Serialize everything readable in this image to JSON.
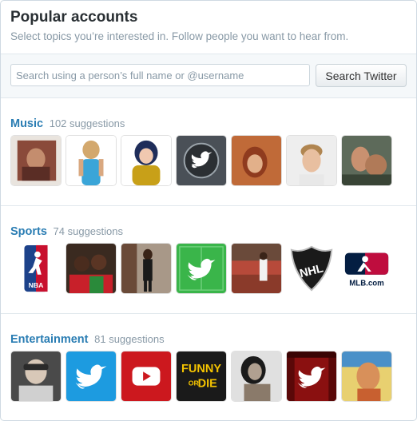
{
  "header": {
    "title": "Popular accounts",
    "subtitle": "Select topics you’re interested in. Follow people you want to hear from."
  },
  "search": {
    "placeholder": "Search using a person’s full name or @username",
    "button_label": "Search Twitter"
  },
  "sections": [
    {
      "name": "Music",
      "count": "102 suggestions",
      "accounts": [
        "photo-avatar",
        "photo-avatar",
        "photo-avatar",
        "twitter-bird-icon",
        "photo-avatar",
        "photo-avatar",
        "photo-avatar"
      ]
    },
    {
      "name": "Sports",
      "count": "74 suggestions",
      "accounts": [
        "nba-logo",
        "photo-avatar",
        "photo-avatar",
        "twitter-bird-icon",
        "photo-avatar",
        "nhl-logo",
        "mlb-logo"
      ],
      "logo_text": {
        "nba": "NBA",
        "nhl": "NHL",
        "mlb": "MLB.com"
      }
    },
    {
      "name": "Entertainment",
      "count": "81 suggestions",
      "accounts": [
        "photo-avatar",
        "twitter-bird-icon",
        "youtube-logo",
        "funny-or-die-logo",
        "photo-avatar",
        "twitter-bird-icon",
        "photo-avatar"
      ],
      "logo_text": {
        "funny_or_die_1": "FUNNY",
        "funny_or_die_2": "OR",
        "funny_or_die_3": "DIE"
      }
    }
  ],
  "colors": {
    "accent": "#2a7db3",
    "twitter_blue": "#1da1f2",
    "sports_green": "#3ab54a",
    "youtube_red": "#cc181e"
  }
}
